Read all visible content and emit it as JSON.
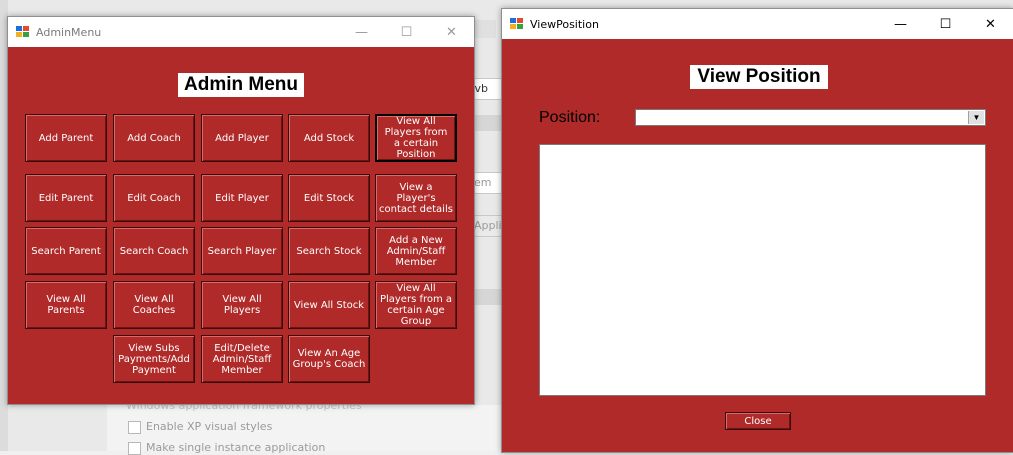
{
  "background_ide": {
    "tab_label": "1.vb",
    "partial_field": "em",
    "partial_button": "Appli",
    "section_label": "Windows application framework properties",
    "checkbox_xp": "Enable XP visual styles",
    "checkbox_single": "Make single instance application"
  },
  "admin_window": {
    "title": "AdminMenu",
    "heading": "Admin Menu",
    "buttons": [
      [
        "Add Parent",
        "Add Coach",
        "Add Player",
        "Add Stock",
        "View All Players from a certain Position"
      ],
      [
        "Edit Parent",
        "Edit Coach",
        "Edit Player",
        "Edit Stock",
        "View a Player's contact details"
      ],
      [
        "Search Parent",
        "Search Coach",
        "Search Player",
        "Search Stock",
        "Add a New Admin/Staff Member"
      ],
      [
        "View All Parents",
        "View All Coaches",
        "View All Players",
        "View All Stock",
        "View All Players from a certain Age Group"
      ],
      [
        "View Subs Payments/Add Payment",
        "Edit/Delete Admin/Staff Member",
        "View An Age Group's Coach"
      ]
    ]
  },
  "view_position_window": {
    "title": "ViewPosition",
    "heading": "View Position",
    "position_label": "Position:",
    "position_value": "",
    "close_label": "Close"
  },
  "colors": {
    "form_bg": "#b02a2a",
    "heading_bg": "#ffffff"
  }
}
